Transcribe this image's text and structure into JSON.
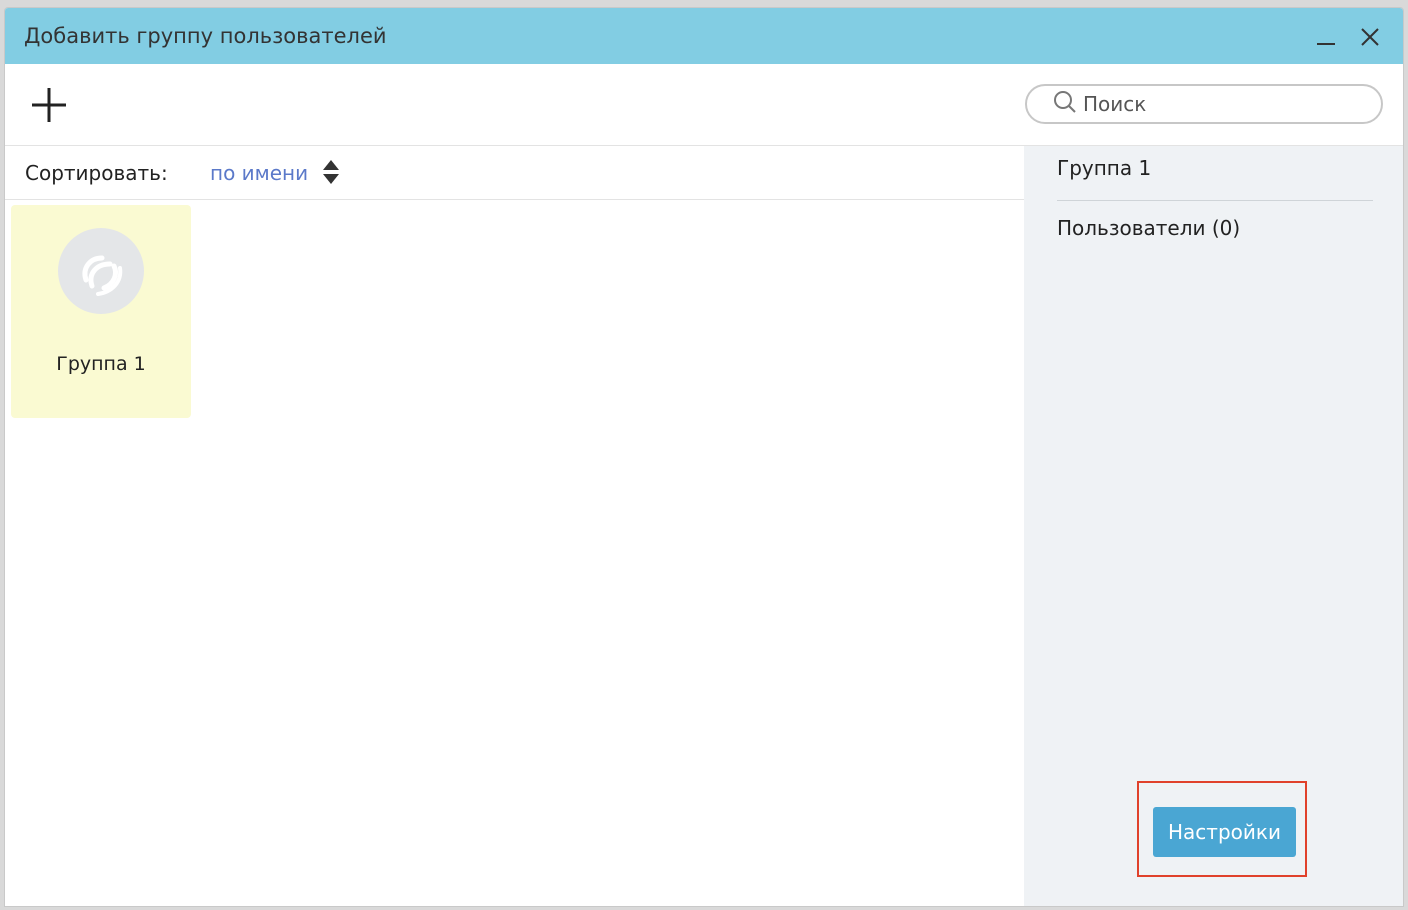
{
  "window": {
    "title": "Добавить группу пользователей"
  },
  "toolbar": {
    "add_icon": "plus-icon",
    "search": {
      "placeholder": "Поиск",
      "value": "",
      "icon": "search-icon"
    }
  },
  "sort": {
    "label": "Сортировать:",
    "value": "по имени",
    "icon": "sort-arrows-icon"
  },
  "groups": [
    {
      "name": "Группа 1",
      "icon": "group-logo-icon",
      "selected": true
    }
  ],
  "details": {
    "group_name": "Группа 1",
    "users_label": "Пользователи (0)",
    "settings_button": "Настройки"
  },
  "colors": {
    "titlebar": "#82cde3",
    "selected_card": "#fafad2",
    "sort_link": "#5b79c9",
    "primary_button": "#4aa6d3",
    "highlight_border": "#e0412b",
    "details_panel": "#eff2f5"
  }
}
